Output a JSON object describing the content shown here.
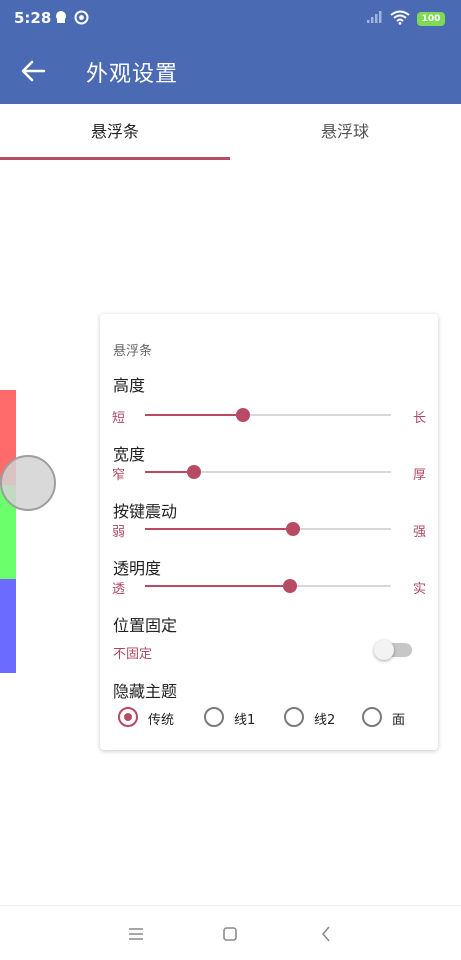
{
  "status_bar": {
    "time": "5:28",
    "battery": "100"
  },
  "app_bar": {
    "title": "外观设置"
  },
  "tabs": [
    {
      "label": "悬浮条",
      "selected": true
    },
    {
      "label": "悬浮球",
      "selected": false
    }
  ],
  "preview": {
    "colors": {
      "red": "#ff6b6b",
      "green": "#6bff6b",
      "blue": "#6b6bff"
    }
  },
  "card": {
    "title": "悬浮条",
    "sliders": [
      {
        "label": "高度",
        "min_label": "短",
        "max_label": "长",
        "value": 0.4
      },
      {
        "label": "宽度",
        "min_label": "窄",
        "max_label": "厚",
        "value": 0.2
      },
      {
        "label": "按键震动",
        "min_label": "弱",
        "max_label": "强",
        "value": 0.6
      },
      {
        "label": "透明度",
        "min_label": "透",
        "max_label": "实",
        "value": 0.59
      }
    ],
    "fixed": {
      "label": "位置固定",
      "value_label": "不固定",
      "on": false
    },
    "theme": {
      "label": "隐藏主题",
      "options": [
        {
          "label": "传统",
          "selected": true
        },
        {
          "label": "线1",
          "selected": false
        },
        {
          "label": "线2",
          "selected": false
        },
        {
          "label": "面",
          "selected": false
        }
      ]
    }
  },
  "accent_color": "#b84a63",
  "appbar_color": "#4a6ab4",
  "icons": {
    "back": "arrow-left-icon",
    "nav_menu": "menu-icon",
    "nav_home": "square-icon",
    "nav_back": "chevron-left-icon"
  }
}
